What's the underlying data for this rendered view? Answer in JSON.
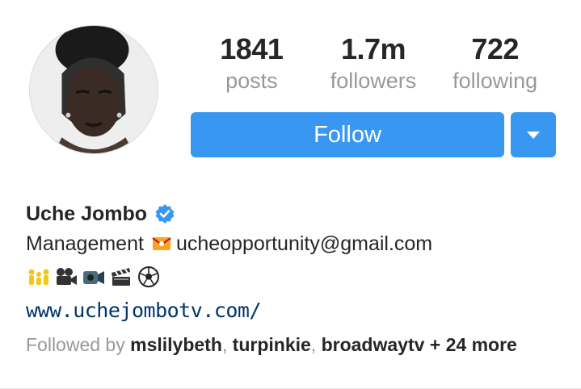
{
  "profile": {
    "stats": [
      {
        "value": "1841",
        "label": "posts"
      },
      {
        "value": "1.7m",
        "label": "followers"
      },
      {
        "value": "722",
        "label": "following"
      }
    ],
    "follow_button": "Follow",
    "name": "Uche Jombo",
    "verified": true,
    "bio_line1": "Management",
    "bio_email": "ucheopportunity@gmail.com",
    "emojis": [
      "family-icon",
      "movie-camera-icon",
      "video-camera-icon",
      "clapper-icon",
      "soccer-ball-icon"
    ],
    "website": "www.uchejombotv.com/",
    "followed_by": {
      "prefix": "Followed by",
      "accounts": [
        "mslilybeth",
        "turpinkie",
        "broadwaytv"
      ],
      "more": "+ 24 more"
    }
  },
  "colors": {
    "accent": "#3897f0",
    "link": "#003569",
    "muted": "#999999",
    "text": "#262626"
  }
}
